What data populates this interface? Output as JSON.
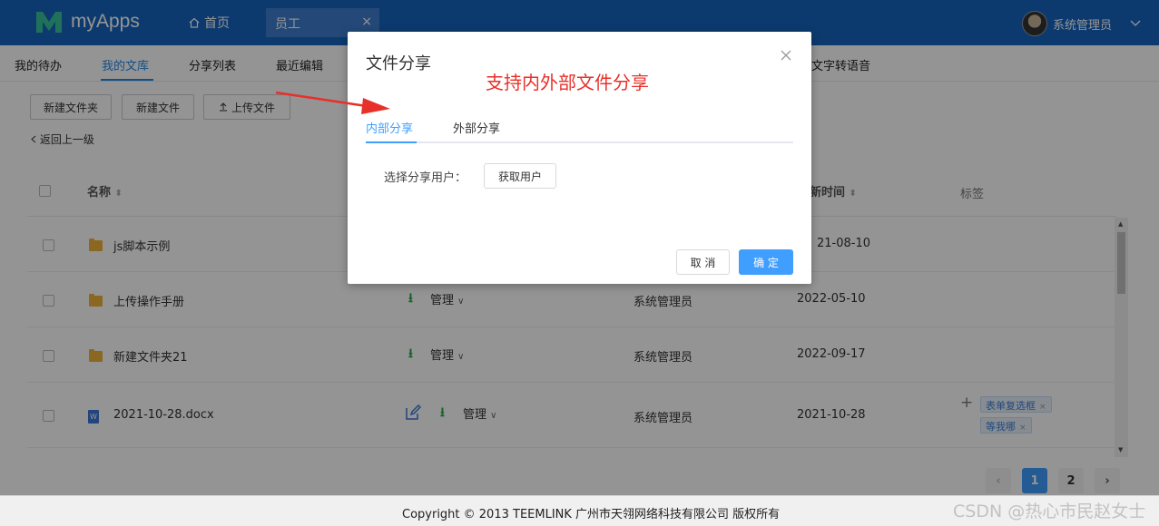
{
  "app": {
    "name": "myApps"
  },
  "header": {
    "home_label": "首页",
    "open_tab_label": "员工",
    "close_symbol": "×",
    "user_name": "系统管理员"
  },
  "subnav": {
    "items": [
      "我的待办",
      "我的文库",
      "分享列表",
      "最近编辑",
      "文字转语音"
    ],
    "active": "我的文库"
  },
  "toolbar": {
    "new_folder": "新建文件夹",
    "new_file": "新建文件",
    "upload": "上传文件",
    "back": "返回上一级"
  },
  "table": {
    "columns": [
      "名称",
      "新时间",
      "标签"
    ],
    "rows": [
      {
        "name": "js脚本示例",
        "type": "folder",
        "action": "",
        "owner": "",
        "date": "21-08-10",
        "tags": []
      },
      {
        "name": "上传操作手册",
        "type": "folder",
        "action": "管理",
        "owner": "系统管理员",
        "date": "2022-05-10",
        "tags": []
      },
      {
        "name": "新建文件夹21",
        "type": "folder",
        "action": "管理",
        "owner": "系统管理员",
        "date": "2022-09-17",
        "tags": []
      },
      {
        "name": "2021-10-28.docx",
        "type": "word",
        "action": "管理",
        "owner": "系统管理员",
        "date": "2021-10-28",
        "tags": [
          "表单复选框",
          "等我哪"
        ]
      }
    ]
  },
  "pagination": {
    "pages": [
      "1",
      "2"
    ],
    "current": "1"
  },
  "footer": {
    "copyright": "Copyright © 2013 TEEMLINK 广州市天翎网络科技有限公司 版权所有",
    "watermark": "CSDN @热心市民赵女士"
  },
  "dialog": {
    "title": "文件分享",
    "annotation": "支持内外部文件分享",
    "tabs": [
      "内部分享",
      "外部分享"
    ],
    "active_tab": "内部分享",
    "select_user_label": "选择分享用户：",
    "get_user_button": "获取用户",
    "cancel_button": "取 消",
    "ok_button": "确 定"
  },
  "colors": {
    "topbar": "#1565c0",
    "accent": "#409eff",
    "annotation": "#e8302a"
  }
}
